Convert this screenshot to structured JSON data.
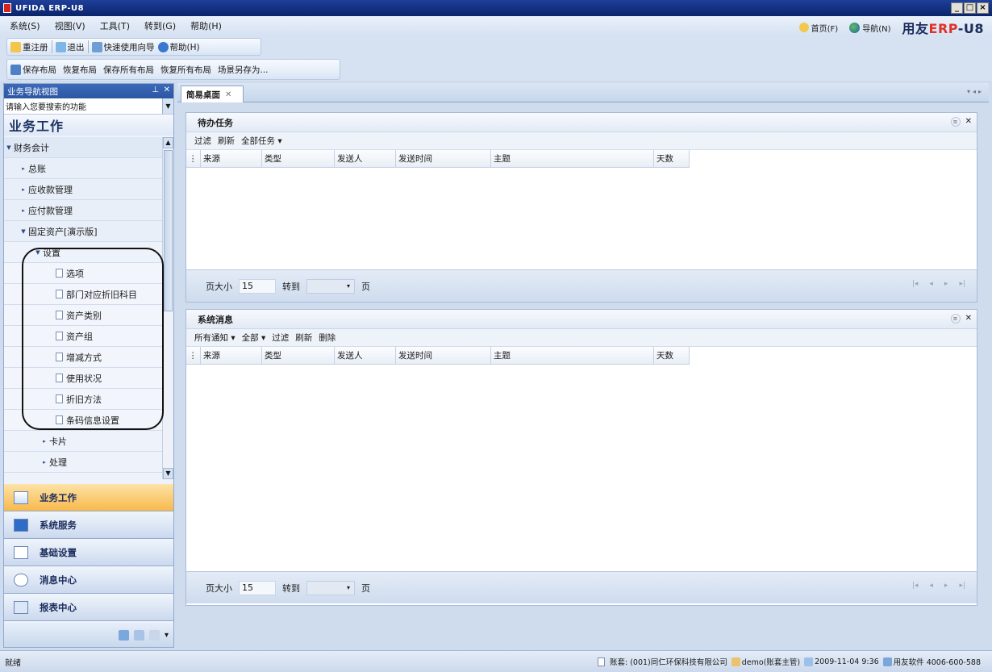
{
  "window": {
    "title": "UFIDA ERP-U8"
  },
  "menu": {
    "items": [
      "系统(S)",
      "视图(V)",
      "工具(T)",
      "转到(G)",
      "帮助(H)"
    ],
    "home": "首页(F)",
    "nav": "导航(N)",
    "brand_prefix": "用友",
    "brand_erp": "ERP",
    "brand_suffix": "-U8"
  },
  "toolbar1": {
    "relogin": "重注册",
    "exit": "退出",
    "wizard": "快速使用向导",
    "help": "帮助(H)"
  },
  "toolbar2": {
    "save_layout": "保存布局",
    "restore_layout": "恢复布局",
    "save_all": "保存所有布局",
    "restore_all": "恢复所有布局",
    "save_scene": "场景另存为..."
  },
  "nav_panel": {
    "title": "业务导航视图",
    "search_placeholder": "请输入您要搜索的功能",
    "section_title": "业务工作",
    "tree": {
      "finance": "财务会计",
      "ledger": "总账",
      "ar": "应收款管理",
      "ap": "应付款管理",
      "fixed_assets": "固定资产[演示版]",
      "settings": "设置",
      "options": "选项",
      "dept_depr": "部门对应折旧科目",
      "asset_category": "资产类别",
      "asset_group": "资产组",
      "change_method": "增减方式",
      "usage_status": "使用状况",
      "depr_method": "折旧方法",
      "barcode": "条码信息设置",
      "card": "卡片",
      "process": "处理"
    },
    "groups": [
      "业务工作",
      "系统服务",
      "基础设置",
      "消息中心",
      "报表中心"
    ]
  },
  "tab": {
    "label": "简易桌面"
  },
  "todo": {
    "title": "待办任务",
    "tools": [
      "过滤",
      "刷新",
      "全部任务"
    ],
    "columns": [
      "来源",
      "类型",
      "发送人",
      "发送时间",
      "主题",
      "天数"
    ],
    "page_size_label": "页大小",
    "page_size": "15",
    "goto_label": "转到",
    "page_label": "页"
  },
  "messages": {
    "title": "系统消息",
    "tools": [
      "所有通知",
      "全部",
      "过滤",
      "刷新",
      "删除"
    ],
    "columns": [
      "来源",
      "类型",
      "发送人",
      "发送时间",
      "主题",
      "天数"
    ],
    "page_size_label": "页大小",
    "page_size": "15",
    "goto_label": "转到",
    "page_label": "页"
  },
  "status": {
    "ready": "就绪",
    "account": "账套: (001)同仁环保科技有限公司",
    "user": "demo(账套主管)",
    "datetime": "2009-11-04 9:36",
    "vendor": "用友软件 4006-600-588"
  },
  "colors": {
    "accent": "#2b56a3",
    "active_group": "#f7b94c",
    "brand_red": "#e0312a"
  }
}
